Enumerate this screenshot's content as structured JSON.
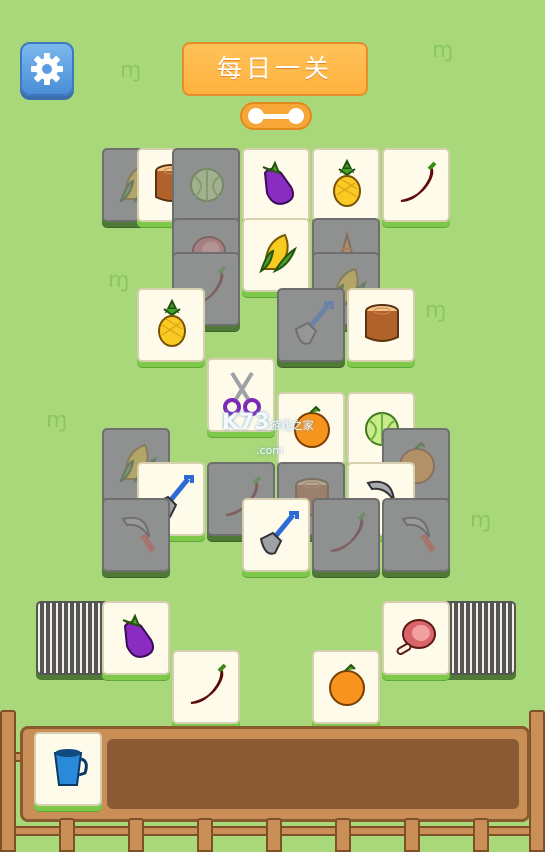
{
  "header": {
    "title": "每日一关"
  },
  "watermark": {
    "brand": "K73",
    "site": "游戏之家",
    "domain": ".com"
  },
  "board": {
    "tiles": [
      {
        "icon": "corn",
        "state": "blocked"
      },
      {
        "icon": "stump",
        "state": "open"
      },
      {
        "icon": "cabbage",
        "state": "blocked"
      },
      {
        "icon": "eggplant",
        "state": "open"
      },
      {
        "icon": "pineapple",
        "state": "open"
      },
      {
        "icon": "chili",
        "state": "open"
      },
      {
        "icon": "ham",
        "state": "blocked"
      },
      {
        "icon": "corn",
        "state": "open"
      },
      {
        "icon": "carrot",
        "state": "blocked"
      },
      {
        "icon": "chili",
        "state": "blocked"
      },
      {
        "icon": "corn",
        "state": "blocked"
      },
      {
        "icon": "pineapple",
        "state": "open"
      },
      {
        "icon": "shovel",
        "state": "blocked"
      },
      {
        "icon": "stump",
        "state": "open"
      },
      {
        "icon": "scissors",
        "state": "open"
      },
      {
        "icon": "orange",
        "state": "open"
      },
      {
        "icon": "cabbage",
        "state": "open"
      },
      {
        "icon": "corn",
        "state": "blocked"
      },
      {
        "icon": "orange",
        "state": "blocked"
      },
      {
        "icon": "shovel",
        "state": "open"
      },
      {
        "icon": "chili",
        "state": "blocked"
      },
      {
        "icon": "stump",
        "state": "blocked"
      },
      {
        "icon": "sickle",
        "state": "open"
      },
      {
        "icon": "sickle",
        "state": "blocked"
      },
      {
        "icon": "shovel",
        "state": "open"
      },
      {
        "icon": "chili",
        "state": "blocked"
      },
      {
        "icon": "sickle",
        "state": "blocked"
      }
    ]
  },
  "side_tiles": [
    {
      "icon": "eggplant",
      "label": "left-deck-top"
    },
    {
      "icon": "chili",
      "label": "left-loose"
    },
    {
      "icon": "orange",
      "label": "right-loose"
    },
    {
      "icon": "ham",
      "label": "right-deck-top"
    }
  ],
  "tray": {
    "slots": [
      {
        "icon": "cup"
      }
    ]
  }
}
